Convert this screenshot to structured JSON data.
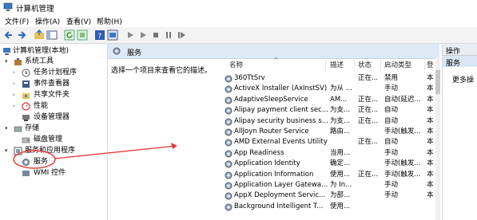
{
  "window": {
    "title": "计算机管理"
  },
  "menu": [
    "文件(F)",
    "操作(A)",
    "查看(V)",
    "帮助(H)"
  ],
  "tree": {
    "root": "计算机管理(本地)",
    "system_tools": "系统工具",
    "task_scheduler": "任务计划程序",
    "event_viewer": "事件查看器",
    "shared_folders": "共享文件夹",
    "performance": "性能",
    "device_manager": "设备管理器",
    "storage": "存储",
    "disk_management": "磁盘管理",
    "services_apps": "服务和应用程序",
    "services": "服务",
    "wmi": "WMI 控件"
  },
  "main": {
    "header_title": "服务",
    "description_prompt": "选择一个项目来查看它的描述。",
    "columns": {
      "name": "名称",
      "description": "描述",
      "status": "状态",
      "startup": "启动类型",
      "logon": "登"
    },
    "services": [
      {
        "name": "360TtSrv",
        "desc": "",
        "status": "正在...",
        "startup": "禁用",
        "logon": "本"
      },
      {
        "name": "ActiveX Installer (AxInstSV)",
        "desc": "为从 ...",
        "status": "",
        "startup": "手动",
        "logon": "本"
      },
      {
        "name": "AdaptiveSleepService",
        "desc": "AM...",
        "status": "正在...",
        "startup": "自动(延迟...",
        "logon": "本"
      },
      {
        "name": "Alipay payment client sec...",
        "desc": "为支...",
        "status": "正在...",
        "startup": "自动",
        "logon": "本"
      },
      {
        "name": "Alipay security business s...",
        "desc": "为支...",
        "status": "正在...",
        "startup": "自动",
        "logon": "本"
      },
      {
        "name": "AllJoyn Router Service",
        "desc": "路由...",
        "status": "",
        "startup": "手动(触发...",
        "logon": "本"
      },
      {
        "name": "AMD External Events Utility",
        "desc": "",
        "status": "正在...",
        "startup": "自动",
        "logon": "本"
      },
      {
        "name": "App Readiness",
        "desc": "当用...",
        "status": "",
        "startup": "手动",
        "logon": "本"
      },
      {
        "name": "Application Identity",
        "desc": "确定...",
        "status": "",
        "startup": "手动(触发...",
        "logon": "本"
      },
      {
        "name": "Application Information",
        "desc": "使用...",
        "status": "正在...",
        "startup": "手动(触发...",
        "logon": "本"
      },
      {
        "name": "Application Layer Gatewa...",
        "desc": "为 In...",
        "status": "",
        "startup": "手动",
        "logon": "本"
      },
      {
        "name": "AppX Deployment Servic...",
        "desc": "为部...",
        "status": "",
        "startup": "手动",
        "logon": "本"
      },
      {
        "name": "Background Intelligent T...",
        "desc": "使用...",
        "status": "",
        "startup": "",
        "logon": ""
      }
    ]
  },
  "actions": {
    "header": "操作",
    "selected": "服务",
    "more": "更多操"
  },
  "colors": {
    "accent": "#0063b1",
    "annotation": "#e53935",
    "header_bg": "#dfe9f5"
  }
}
